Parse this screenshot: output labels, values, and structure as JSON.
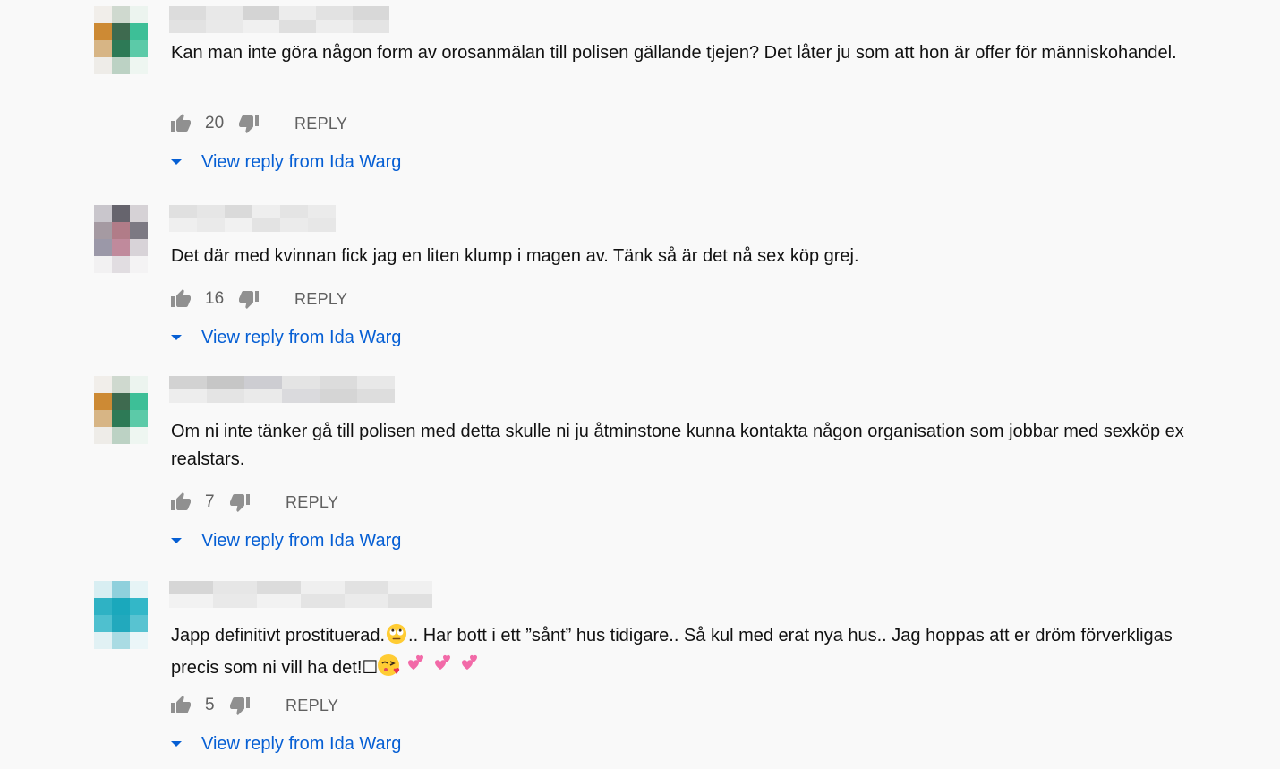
{
  "comments": [
    {
      "text": "Kan man inte göra någon form av orosanmälan till polisen gällande tjejen? Det låter ju som att hon är offer för människohandel.",
      "likes": "20",
      "reply_label": "REPLY",
      "view_reply_label": "View reply from Ida Warg",
      "avatar_colors": [
        "#f1eeea",
        "#cfd9cf",
        "#ecf4ef",
        "#cd8a34",
        "#3e6a4f",
        "#3dbf97",
        "#d7b585",
        "#2d7a56",
        "#5ccaa8",
        "#eeece8",
        "#bcd2c4",
        "#eef6f1"
      ],
      "name_blur": [
        "#dcdcdc",
        "#e8e8e8",
        "#d4d4d4",
        "#ececec",
        "#e2e2e2",
        "#d8d8d8"
      ]
    },
    {
      "text": "Det där med kvinnan fick jag en liten klump i magen av. Tänk så är det nå sex köp grej.",
      "likes": "16",
      "reply_label": "REPLY",
      "view_reply_label": "View reply from Ida Warg",
      "avatar_colors": [
        "#c9c6cc",
        "#66646d",
        "#d6d2d6",
        "#a59aa2",
        "#b17c88",
        "#7c7983",
        "#9b98a8",
        "#c08a9c",
        "#d8d3d8",
        "#f2f1f2",
        "#e1dde1",
        "#f4f3f4"
      ],
      "name_blur": [
        "#e0e0e0",
        "#e6e6e6",
        "#dadada",
        "#eeeeee",
        "#e4e4e4",
        "#ebebeb"
      ]
    },
    {
      "text": "Om ni inte tänker gå till polisen med detta skulle ni ju åtminstone kunna kontakta någon organisation som jobbar med sexköp ex realstars.",
      "likes": "7",
      "reply_label": "REPLY",
      "view_reply_label": "View reply from Ida Warg",
      "avatar_colors": [
        "#f1eeea",
        "#cfd9cf",
        "#ecf4ef",
        "#cd8a34",
        "#3e6a4f",
        "#3dbf97",
        "#d7b585",
        "#2d7a56",
        "#5ccaa8",
        "#eeece8",
        "#bcd2c4",
        "#eef6f1"
      ],
      "name_blur": [
        "#d2d2d2",
        "#c6c6c6",
        "#cdcdd2",
        "#e4e4e4",
        "#dcdcdc",
        "#e8e8e8"
      ]
    },
    {
      "text_before": "Japp definitivt prostituerad.",
      "text_after": ".. Har bott i ett ”sånt” hus tidigare.. Så kul med erat nya hus.. Jag hoppas att er dröm förverkligas precis som ni vill ha det!",
      "box_glyph": "☐",
      "likes": "5",
      "reply_label": "REPLY",
      "view_reply_label": "View reply from Ida Warg",
      "avatar_colors": [
        "#d8eef2",
        "#8fd0dc",
        "#e6f4f6",
        "#2fb2c4",
        "#1aa8bc",
        "#33b7c8",
        "#4fc0cf",
        "#22a9bd",
        "#58c3d1",
        "#e1f1f4",
        "#a9dbe3",
        "#ebf6f8"
      ],
      "name_blur": [
        "#d6d6d6",
        "#e6e6e6",
        "#dcdcdc",
        "#efefef",
        "#e2e2e2",
        "#f0f0f0"
      ]
    }
  ],
  "icons": {
    "like": "thumb-up-icon",
    "dislike": "thumb-down-icon",
    "expand": "caret-down-icon",
    "rolling_eyes": "rolling-eyes-emoji",
    "kiss": "face-blowing-kiss-emoji",
    "hearts": "two-hearts-emoji"
  },
  "colors": {
    "link": "#065fd4",
    "muted": "#606060",
    "text": "#111111",
    "background": "#f9f9f9"
  }
}
